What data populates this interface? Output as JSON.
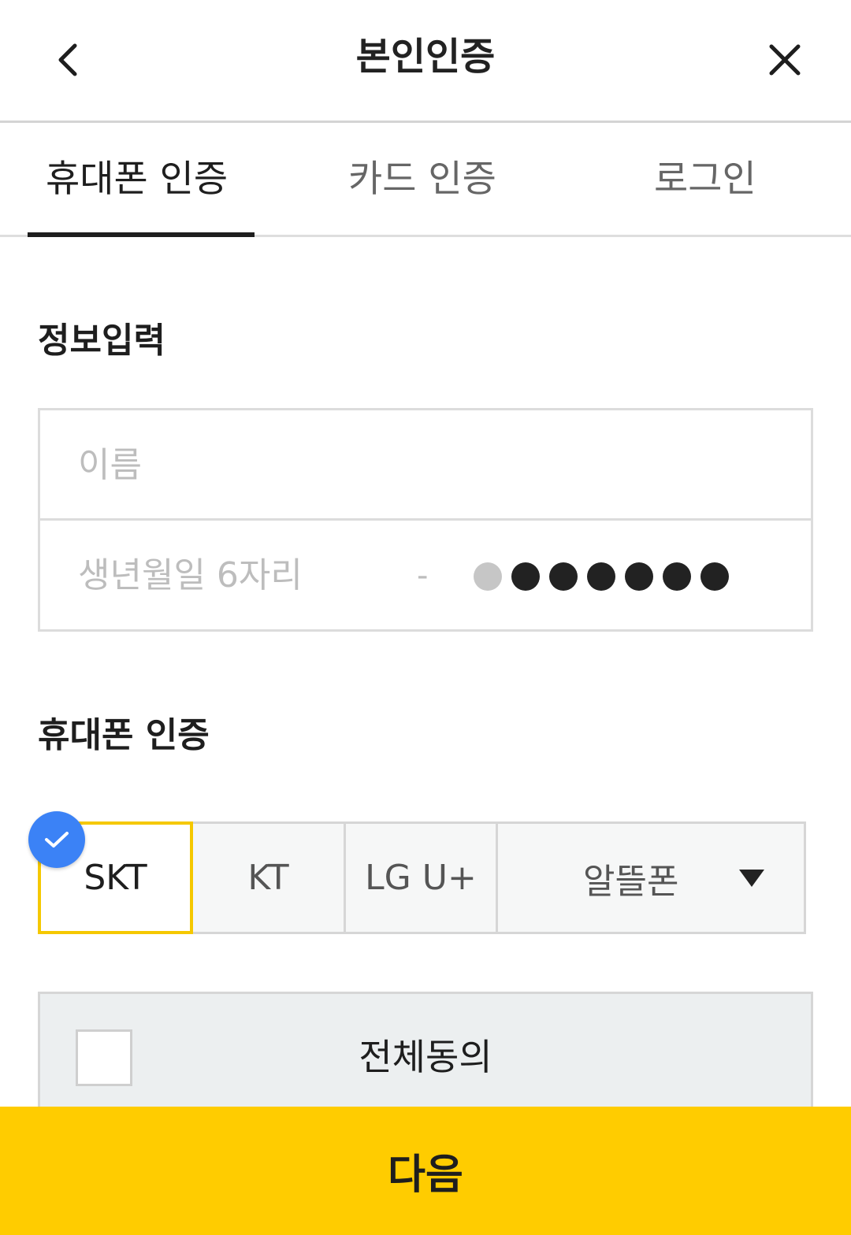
{
  "header": {
    "title": "본인인증"
  },
  "tabs": [
    {
      "label": "휴대폰 인증",
      "active": true
    },
    {
      "label": "카드 인증",
      "active": false
    },
    {
      "label": "로그인",
      "active": false
    }
  ],
  "info": {
    "section_title": "정보입력",
    "name_placeholder": "이름",
    "birth_placeholder": "생년월일 6자리",
    "separator": "-"
  },
  "phone": {
    "section_title": "휴대폰 인증",
    "carriers": [
      {
        "label": "SKT",
        "selected": true
      },
      {
        "label": "KT",
        "selected": false
      },
      {
        "label": "LG U+",
        "selected": false
      },
      {
        "label": "알뜰폰",
        "selected": false
      }
    ]
  },
  "agree": {
    "label": "전체동의",
    "checked": false
  },
  "next_button": {
    "label": "다음"
  },
  "colors": {
    "accent_yellow": "#ffcc00",
    "selected_border": "#f5c800",
    "check_blue": "#3b82f6"
  }
}
